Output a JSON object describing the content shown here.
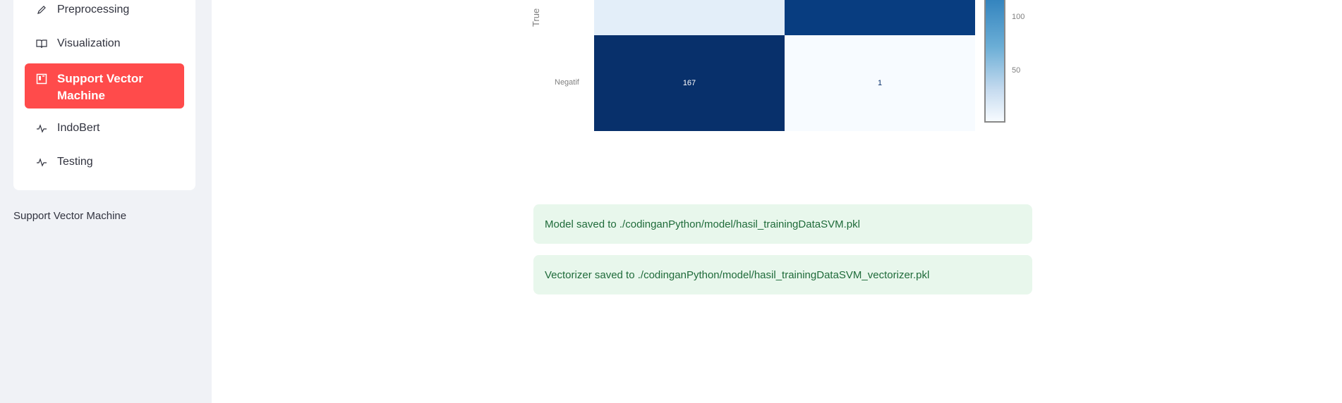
{
  "sidebar": {
    "items": [
      {
        "label": "Preprocessing",
        "icon": "pencil-icon"
      },
      {
        "label": "Visualization",
        "icon": "book-icon"
      },
      {
        "label": "Support Vector Machine",
        "icon": "table-icon",
        "active": true
      },
      {
        "label": "IndoBert",
        "icon": "activity-icon"
      },
      {
        "label": "Testing",
        "icon": "activity-icon"
      }
    ],
    "caption": "Support Vector Machine"
  },
  "chart_data": {
    "type": "heatmap",
    "ylabel": "True",
    "y_categories": [
      "",
      "Negatif"
    ],
    "cells": [
      [
        null,
        null
      ],
      [
        167,
        1
      ]
    ],
    "colorbar_ticks": [
      "100",
      "50"
    ],
    "colors": {
      "dark": "#08306b",
      "dark2": "#083d80",
      "light": "#e3eef9",
      "lightest": "#f7fbff"
    }
  },
  "alerts": [
    {
      "text": "Model saved to ./codinganPython/model/hasil_trainingDataSVM.pkl"
    },
    {
      "text": "Vectorizer saved to ./codinganPython/model/hasil_trainingDataSVM_vectorizer.pkl"
    }
  ]
}
